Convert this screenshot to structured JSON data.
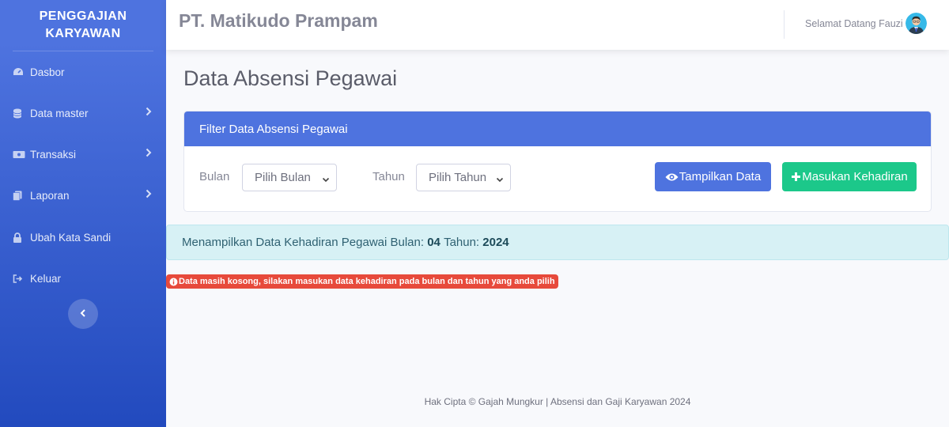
{
  "sidebar": {
    "brand_line1": "PENGGAJIAN",
    "brand_line2": "KARYAWAN",
    "items": [
      {
        "label": "Dasbor",
        "icon": "dashboard-icon"
      },
      {
        "label": "Data master",
        "icon": "database-icon"
      },
      {
        "label": "Transaksi",
        "icon": "money-icon"
      },
      {
        "label": "Laporan",
        "icon": "copy-icon"
      },
      {
        "label": "Ubah Kata Sandi",
        "icon": "lock-icon"
      },
      {
        "label": "Keluar",
        "icon": "sign-out-icon"
      }
    ]
  },
  "topbar": {
    "company": "PT. Matikudo Prampam",
    "welcome": "Selamat Datang Fauzi"
  },
  "main": {
    "title": "Data Absensi Pegawai",
    "filter": {
      "header": "Filter Data Absensi Pegawai",
      "month_label": "Bulan",
      "month_value": "Pilih Bulan",
      "year_label": "Tahun",
      "year_value": "Pilih Tahun",
      "show_button": "Tampilkan Data",
      "add_button": "Masukan Kehadiran"
    },
    "info": {
      "prefix": "Menampilkan Data Kehadiran Pegawai Bulan:",
      "month": "04",
      "year_label": "Tahun:",
      "year": "2024"
    },
    "empty_message": "Data masih kosong, silakan masukan data kehadiran pada bulan dan tahun yang anda pilih"
  },
  "footer": {
    "text": "Hak Cipta © Gajah Mungkur | Absensi dan Gaji Karyawan 2024"
  },
  "colors": {
    "primary": "#4e73df",
    "success": "#1cc88a",
    "danger": "#e74a3b",
    "info_bg": "#d7f1f5"
  }
}
